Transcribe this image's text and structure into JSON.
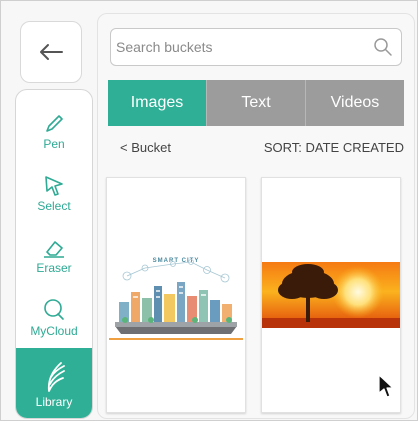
{
  "toolbar": {
    "back_icon": "arrow-left-icon",
    "tools": [
      {
        "label": "Pen",
        "icon": "pen-icon",
        "active": false
      },
      {
        "label": "Select",
        "icon": "pointer-icon",
        "active": false
      },
      {
        "label": "Eraser",
        "icon": "eraser-icon",
        "active": false
      },
      {
        "label": "MyCloud",
        "icon": "magnifier-icon",
        "active": false
      },
      {
        "label": "Library",
        "icon": "library-icon",
        "active": true
      }
    ]
  },
  "search": {
    "placeholder": "Search buckets",
    "value": ""
  },
  "tabs": [
    {
      "label": "Images",
      "active": true
    },
    {
      "label": "Text",
      "active": false
    },
    {
      "label": "Videos",
      "active": false
    }
  ],
  "nav": {
    "back_label": "< Bucket",
    "sort_label": "SORT: DATE CREATED"
  },
  "cards": [
    {
      "thumbnail": "smart-city-illustration",
      "caption": "SMART CITY"
    },
    {
      "thumbnail": "sunset-tree-photo"
    }
  ],
  "colors": {
    "accent": "#2fb096",
    "tab_inactive": "#9c9c9c"
  }
}
